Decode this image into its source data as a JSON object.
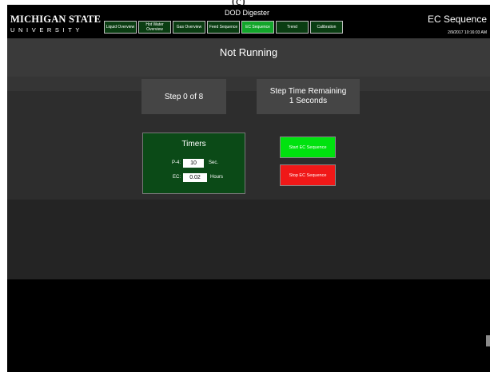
{
  "panel_label": "(c)",
  "header": {
    "logo_line1": "MICHIGAN STATE",
    "logo_line2": "UNIVERSITY",
    "app_title": "DOD Digester",
    "screen_title": "EC Sequence",
    "timestamp": "2/9/2017 10:16:03 AM",
    "tabs": [
      {
        "label": "Liquid Overview",
        "active": false
      },
      {
        "label": "Hot Water Overview",
        "active": false
      },
      {
        "label": "Gas Overview",
        "active": false
      },
      {
        "label": "Feed Sequence",
        "active": false
      },
      {
        "label": "EC Sequence",
        "active": true
      },
      {
        "label": "Trend",
        "active": false
      },
      {
        "label": "Calibration",
        "active": false
      }
    ]
  },
  "status": "Not Running",
  "step": "Step 0 of 8",
  "step_time": {
    "label": "Step Time Remaining",
    "value": "1 Seconds"
  },
  "timers": {
    "title": "Timers",
    "rows": [
      {
        "label": "P-4:",
        "value": "10",
        "unit": "Sec."
      },
      {
        "label": "EC:",
        "value": "0.02",
        "unit": "Hours"
      }
    ]
  },
  "buttons": {
    "start": "Start EC Sequence",
    "stop": "Stop EC Sequence"
  },
  "colors": {
    "active_tab": "#12a52a",
    "inactive_tab": "#0a3d12",
    "start_button": "#00e20f",
    "stop_button": "#f01818",
    "timers_panel": "#0b4a17"
  }
}
